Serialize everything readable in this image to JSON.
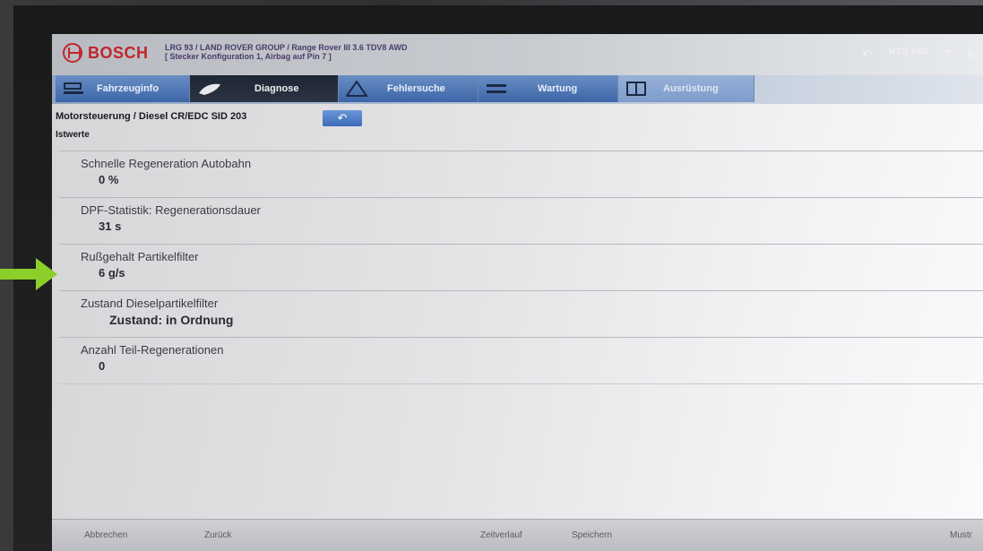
{
  "header": {
    "brand": "BOSCH",
    "vehicle_line1": "LRG 93 / LAND ROVER GROUP / Range Rover III 3.6 TDV8 AWD",
    "vehicle_line2": "[ Stecker Konfiguration 1, Airbag auf Pin 7 ]",
    "kts_label": "KTS 540",
    "help_label": "?"
  },
  "tabs": [
    {
      "label": "Fahrzeuginfo",
      "icon": "car-lift-icon"
    },
    {
      "label": "Diagnose",
      "icon": "stethoscope-icon"
    },
    {
      "label": "Fehlersuche",
      "icon": "warning-triangle-icon"
    },
    {
      "label": "Wartung",
      "icon": "wrench-icon"
    },
    {
      "label": "Ausrüstung",
      "icon": "book-icon"
    }
  ],
  "breadcrumb": "Motorsteuerung / Diesel CR/EDC SID 203",
  "section": "Istwerte",
  "values": [
    {
      "name": "Schnelle Regeneration Autobahn",
      "value": "0 %"
    },
    {
      "name": "DPF-Statistik: Regenerationsdauer",
      "value": "31 s"
    },
    {
      "name": "Rußgehalt Partikelfilter",
      "value": "6 g/s"
    },
    {
      "name": "Zustand Dieselpartikelfilter",
      "value": "Zustand: in Ordnung"
    },
    {
      "name": "Anzahl Teil-Regenerationen",
      "value": "0"
    }
  ],
  "footer": {
    "abort": "Abbrechen",
    "back": "Zurück",
    "timeline": "Zeitverlauf",
    "save": "Speichern",
    "more": "Mustr"
  },
  "colors": {
    "brand_red": "#c0262a",
    "tab_blue": "#3c66a8",
    "tab_active": "#1e2634",
    "annotation_arrow": "#8ccf2a"
  }
}
